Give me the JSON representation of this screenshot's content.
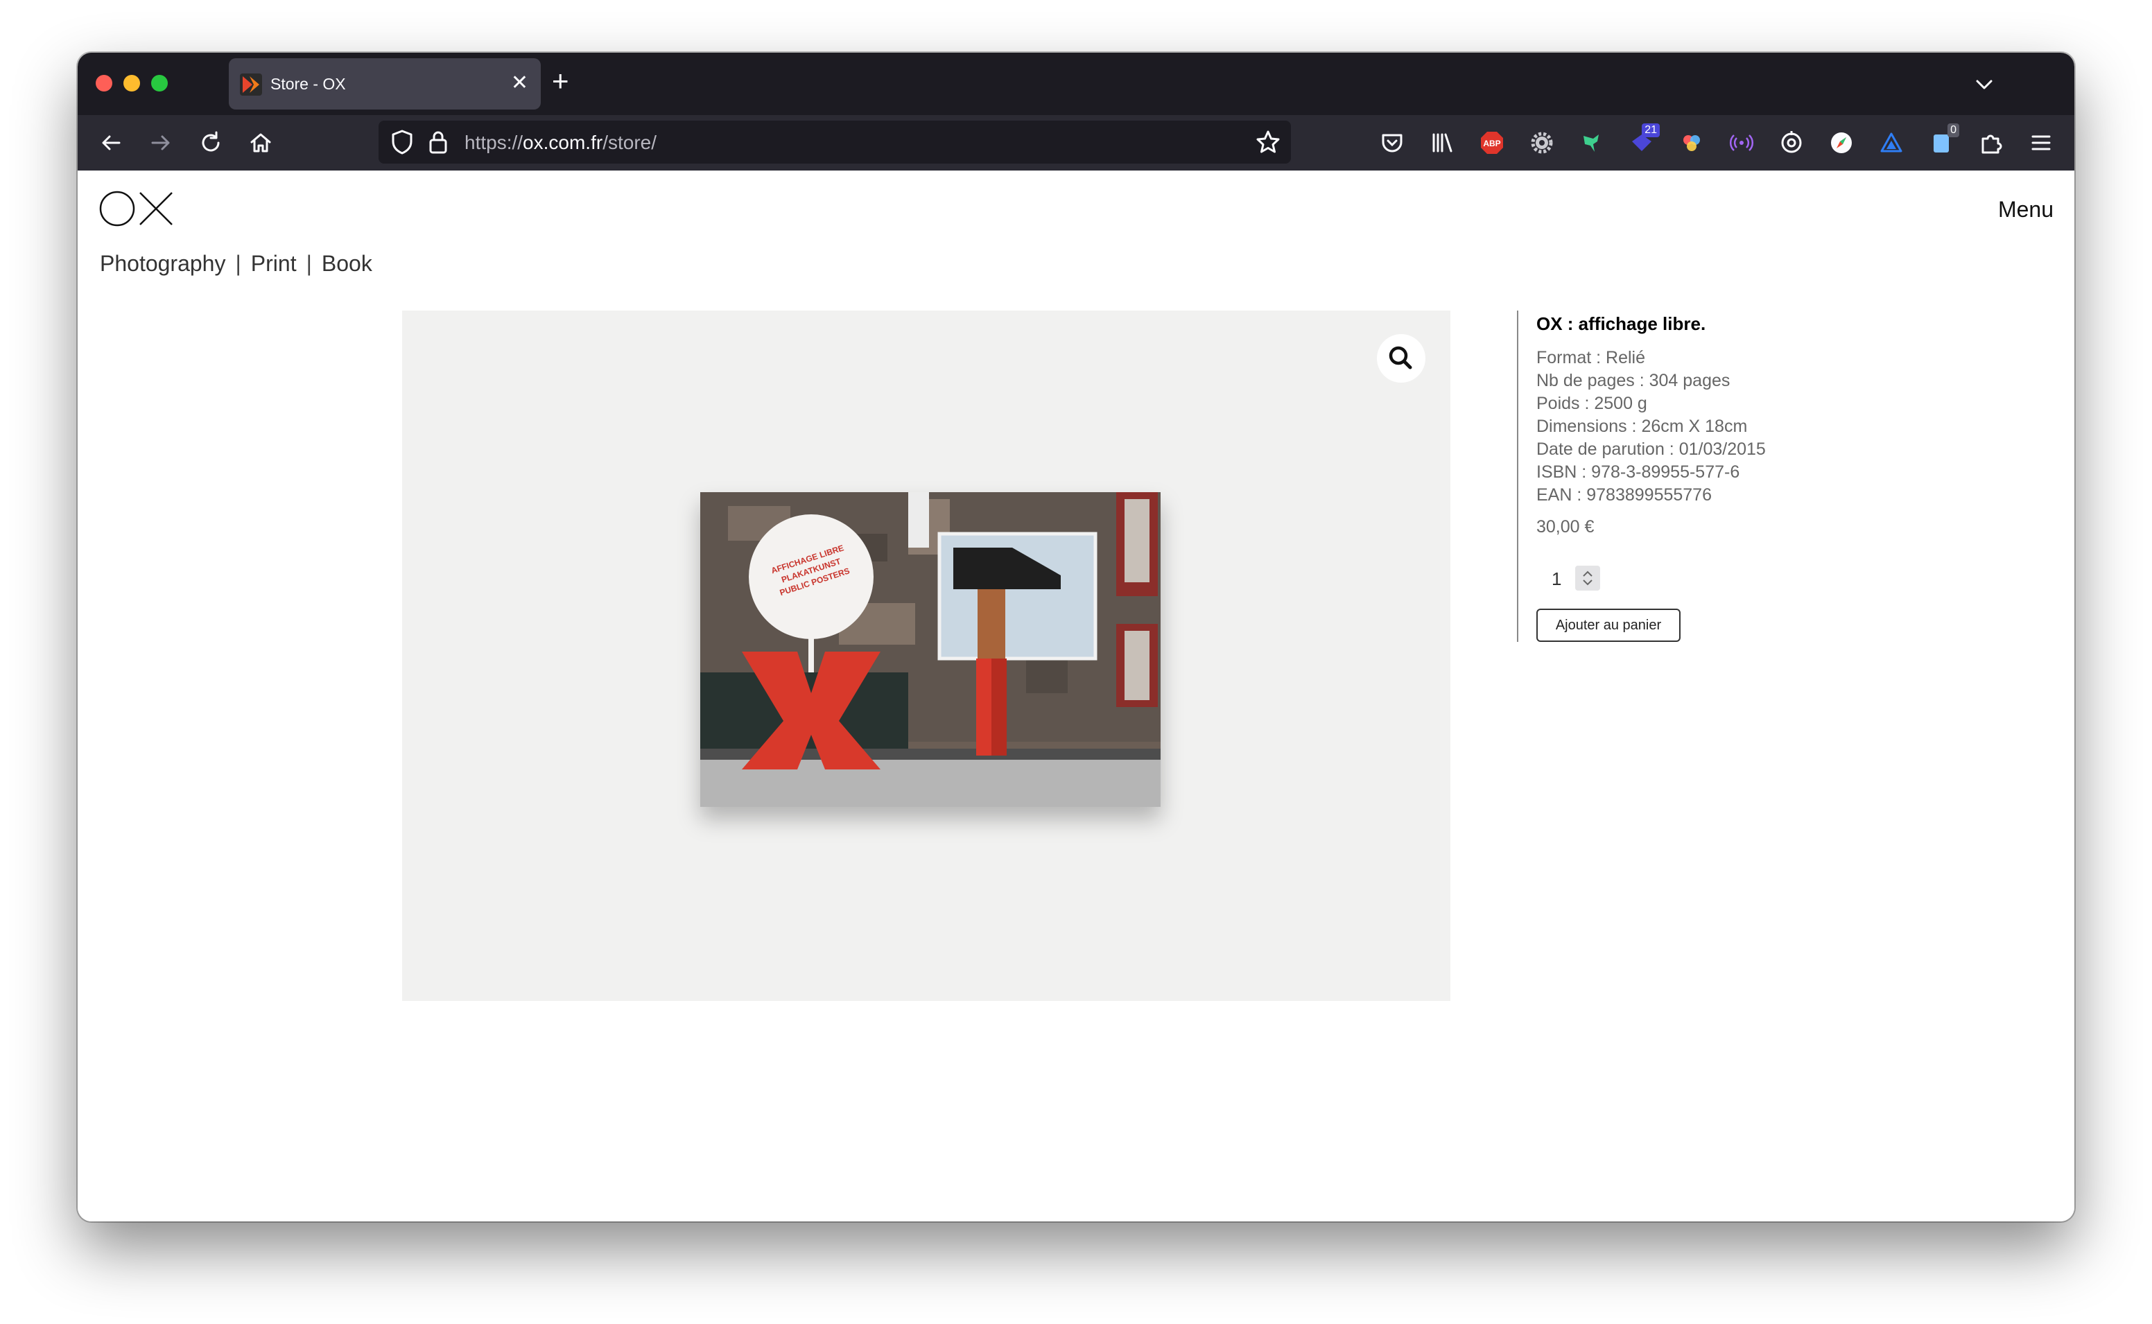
{
  "browser": {
    "tab": {
      "title": "Store - OX",
      "close": "✕"
    },
    "new_tab": "+",
    "url": {
      "scheme": "https://",
      "host": "ox.com.fr",
      "path": "/store/"
    },
    "toolbar_badges": {
      "extension_counter": "21",
      "clipboard_counter": "0"
    },
    "icons": [
      "back-icon",
      "forward-icon",
      "reload-icon",
      "home-icon",
      "shield-icon",
      "lock-icon",
      "bookmark-star-icon",
      "pocket-icon",
      "library-icon",
      "adblock-icon",
      "gear-extension-icon",
      "bird-extension-icon",
      "tag-extension-icon",
      "colors-extension-icon",
      "radio-extension-icon",
      "target-extension-icon",
      "compass-extension-icon",
      "triangle-extension-icon",
      "clipboard-extension-icon",
      "puzzle-icon",
      "hamburger-menu-icon"
    ]
  },
  "site": {
    "logo_alt": "OX",
    "menu_label": "Menu",
    "categories": [
      "Photography",
      "Print",
      "Book"
    ],
    "separator": "|"
  },
  "product": {
    "title": "OX : affichage libre.",
    "attributes": [
      "Format : Relié",
      "Nb de pages : 304 pages",
      "Poids : 2500 g",
      "Dimensions : 26cm X 18cm",
      "Date de parution : 01/03/2015",
      "ISBN : 978-3-89955-577-6",
      "EAN : 9783899555776"
    ],
    "price": "30,00 €",
    "quantity": "1",
    "add_to_cart_label": "Ajouter au panier",
    "cover_sticker": [
      "AFFICHAGE LIBRE",
      "PLAKATKUNST",
      "PUBLIC POSTERS"
    ]
  },
  "colors": {
    "tabbar_bg": "#1c1b22",
    "navbar_bg": "#2b2a33",
    "accent_red": "#d8392b"
  }
}
